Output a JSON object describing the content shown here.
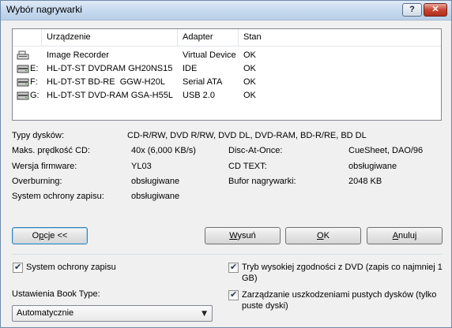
{
  "window": {
    "title": "Wybór nagrywarki",
    "help_label": "?",
    "close_label": "✕"
  },
  "devices": {
    "columns": [
      "Urządzenie",
      "Adapter",
      "Stan"
    ],
    "rows": [
      {
        "letter": "",
        "name": "Image Recorder",
        "adapter": "Virtual Device",
        "status": "OK",
        "icon": "image-recorder-icon"
      },
      {
        "letter": "E:",
        "name": "HL-DT-ST DVDRAM GH20NS15",
        "adapter": "IDE",
        "status": "OK",
        "icon": "optical-drive-icon"
      },
      {
        "letter": "F:",
        "name": "HL-DT-ST BD-RE  GGW-H20L",
        "adapter": "Serial ATA",
        "status": "OK",
        "icon": "optical-drive-icon"
      },
      {
        "letter": "G:",
        "name": "HL-DT-ST DVD-RAM GSA-H55L",
        "adapter": "USB 2.0",
        "status": "OK",
        "icon": "optical-drive-icon"
      }
    ]
  },
  "info": {
    "disc_types_label": "Typy dysków:",
    "disc_types_value": "CD-R/RW, DVD R/RW, DVD DL, DVD-RAM, BD-R/RE, BD DL",
    "max_speed_label": "Maks. prędkość CD:",
    "max_speed_value": "40x (6,000 KB/s)",
    "firmware_label": "Wersja firmware:",
    "firmware_value": "YL03",
    "overburning_label": "Overburning:",
    "overburning_value": "obsługiwane",
    "protection_label": "System ochrony zapisu:",
    "protection_value": "obsługiwane",
    "dao_label": "Disc-At-Once:",
    "dao_value": "CueSheet, DAO/96",
    "cdtext_label": "CD TEXT:",
    "cdtext_value": "obsługiwane",
    "buffer_label": "Bufor nagrywarki:",
    "buffer_value": "2048 KB"
  },
  "buttons": {
    "options": {
      "pre": "O",
      "key": "p",
      "post": "cje <<"
    },
    "eject": {
      "pre": "",
      "key": "W",
      "post": "ysuń"
    },
    "ok": {
      "pre": "",
      "key": "O",
      "post": "K"
    },
    "cancel": {
      "pre": "",
      "key": "A",
      "post": "nuluj"
    }
  },
  "options": {
    "write_protection_label": "System ochrony zapisu",
    "booktype_label": "Ustawienia Book Type:",
    "booktype_value": "Automatycznie",
    "dvd_compat_line1": "Tryb wysokiej zgodności z DVD (zapis co najmniej 1",
    "dvd_compat_line2": "GB)",
    "damage_line1": "Zarządzanie uszkodzeniami pustych dysków (tylko",
    "damage_line2": "puste dyski)",
    "write_protection_checked": true,
    "dvd_compat_checked": true,
    "damage_checked": true
  },
  "colors": {
    "accent": "#3c7fb1",
    "close": "#c84531"
  }
}
